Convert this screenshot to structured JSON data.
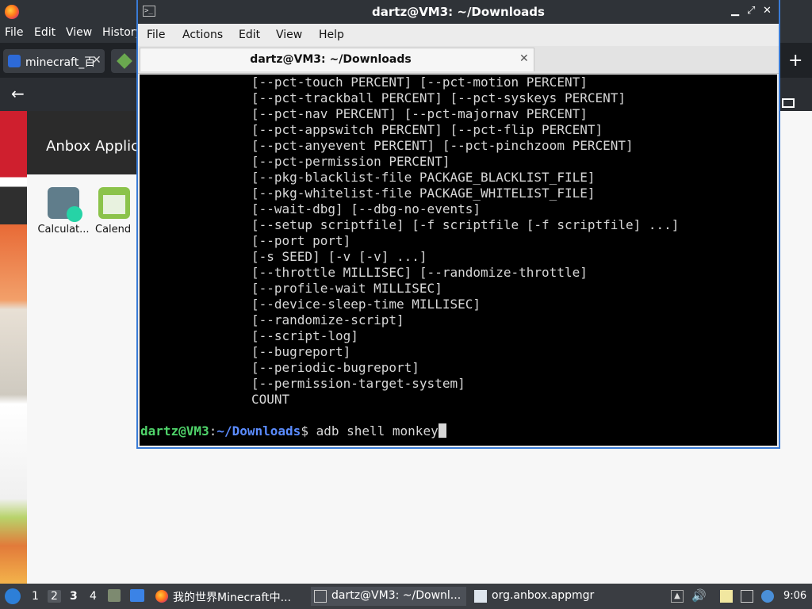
{
  "firefox": {
    "menu": {
      "file": "File",
      "edit": "Edit",
      "view": "View",
      "history": "History"
    },
    "tabs": [
      {
        "label": "minecraft_百"
      }
    ],
    "anbox_title": "Anbox Applic",
    "apps": [
      {
        "label": "Calculat..."
      },
      {
        "label": "Calend"
      }
    ]
  },
  "terminal": {
    "window_title": "dartz@VM3: ~/Downloads",
    "menu": {
      "file": "File",
      "actions": "Actions",
      "edit": "Edit",
      "view": "View",
      "help": "Help"
    },
    "tab_title": "dartz@VM3: ~/Downloads",
    "output_lines": [
      "[--pct-touch PERCENT] [--pct-motion PERCENT]",
      "[--pct-trackball PERCENT] [--pct-syskeys PERCENT]",
      "[--pct-nav PERCENT] [--pct-majornav PERCENT]",
      "[--pct-appswitch PERCENT] [--pct-flip PERCENT]",
      "[--pct-anyevent PERCENT] [--pct-pinchzoom PERCENT]",
      "[--pct-permission PERCENT]",
      "[--pkg-blacklist-file PACKAGE_BLACKLIST_FILE]",
      "[--pkg-whitelist-file PACKAGE_WHITELIST_FILE]",
      "[--wait-dbg] [--dbg-no-events]",
      "[--setup scriptfile] [-f scriptfile [-f scriptfile] ...]",
      "[--port port]",
      "[-s SEED] [-v [-v] ...]",
      "[--throttle MILLISEC] [--randomize-throttle]",
      "[--profile-wait MILLISEC]",
      "[--device-sleep-time MILLISEC]",
      "[--randomize-script]",
      "[--script-log]",
      "[--bugreport]",
      "[--periodic-bugreport]",
      "[--permission-target-system]",
      "COUNT"
    ],
    "prompt": {
      "user": "dartz@VM3",
      "sep": ":",
      "path": "~/Downloads",
      "symbol": "$ ",
      "command": "adb shell monkey"
    }
  },
  "taskbar": {
    "workspaces": [
      "1",
      "2",
      "3",
      "4"
    ],
    "tasks": [
      {
        "label": "我的世界Minecraft中..."
      },
      {
        "label": "dartz@VM3: ~/Downl..."
      },
      {
        "label": "org.anbox.appmgr"
      }
    ],
    "clock": "9:06"
  }
}
